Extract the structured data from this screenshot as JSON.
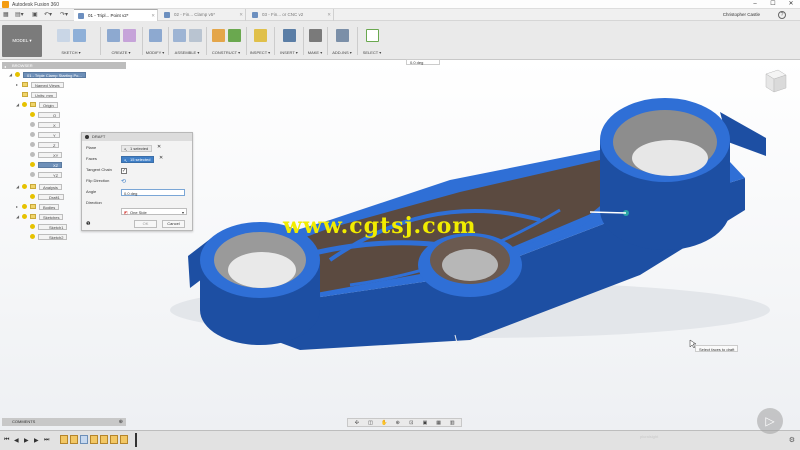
{
  "window": {
    "title": "Autodesk Fusion 360"
  },
  "quick_access": {
    "user": "Christopher Castle",
    "tabs": [
      {
        "label": "01 - Tripl... Point v2*",
        "active": true
      },
      {
        "label": "02 - Fin... Clamp v5*",
        "active": false
      },
      {
        "label": "03 - Fin... or CNC v2",
        "active": false
      }
    ]
  },
  "toolbar": {
    "workspace": "MODEL ▾",
    "groups": [
      {
        "label": "SKETCH ▾"
      },
      {
        "label": "CREATE ▾"
      },
      {
        "label": "MODIFY ▾"
      },
      {
        "label": "ASSEMBLE ▾"
      },
      {
        "label": "CONSTRUCT ▾"
      },
      {
        "label": "INSPECT ▾"
      },
      {
        "label": "INSERT ▾"
      },
      {
        "label": "MAKE ▾"
      },
      {
        "label": "ADD-INS ▾"
      },
      {
        "label": "SELECT ▾"
      }
    ]
  },
  "browser": {
    "header": "BROWSER",
    "root": "01 - Triple Clamp Starting Po...",
    "items": [
      {
        "label": "Named Views"
      },
      {
        "label": "Units: mm"
      },
      {
        "label": "Origin"
      },
      {
        "label": "O"
      },
      {
        "label": "X"
      },
      {
        "label": "Y"
      },
      {
        "label": "Z"
      },
      {
        "label": "XY"
      },
      {
        "label": "XZ"
      },
      {
        "label": "YZ"
      },
      {
        "label": "Analysis"
      },
      {
        "label": "Draft1"
      },
      {
        "label": "Bodies"
      },
      {
        "label": "Sketches"
      },
      {
        "label": "Sketch1"
      },
      {
        "label": "Sketch2"
      }
    ]
  },
  "draft_dialog": {
    "title": "DRAFT",
    "plane_label": "Plane",
    "plane_value": "1 selected",
    "faces_label": "Faces",
    "faces_value": "15 selected",
    "tangent_label": "Tangent Chain",
    "flip_label": "Flip Direction",
    "angle_label": "Angle",
    "angle_value": "0.0 deg",
    "direction_label": "Direction",
    "direction_value": "One Side",
    "ok_label": "OK",
    "cancel_label": "Cancel"
  },
  "viewport": {
    "angle_readout": "0.0 deg",
    "tooltip": "Select faces to draft",
    "watermark": "www.cgtsj.com"
  },
  "bottom": {
    "comments": "COMMENTS",
    "pluralsight": "pluralsight"
  },
  "colors": {
    "part_blue": "#2f6fd6",
    "part_dark": "#1d4fa3",
    "pocket_brown": "#5b4a40",
    "selected_face": "#3f7fc7"
  }
}
